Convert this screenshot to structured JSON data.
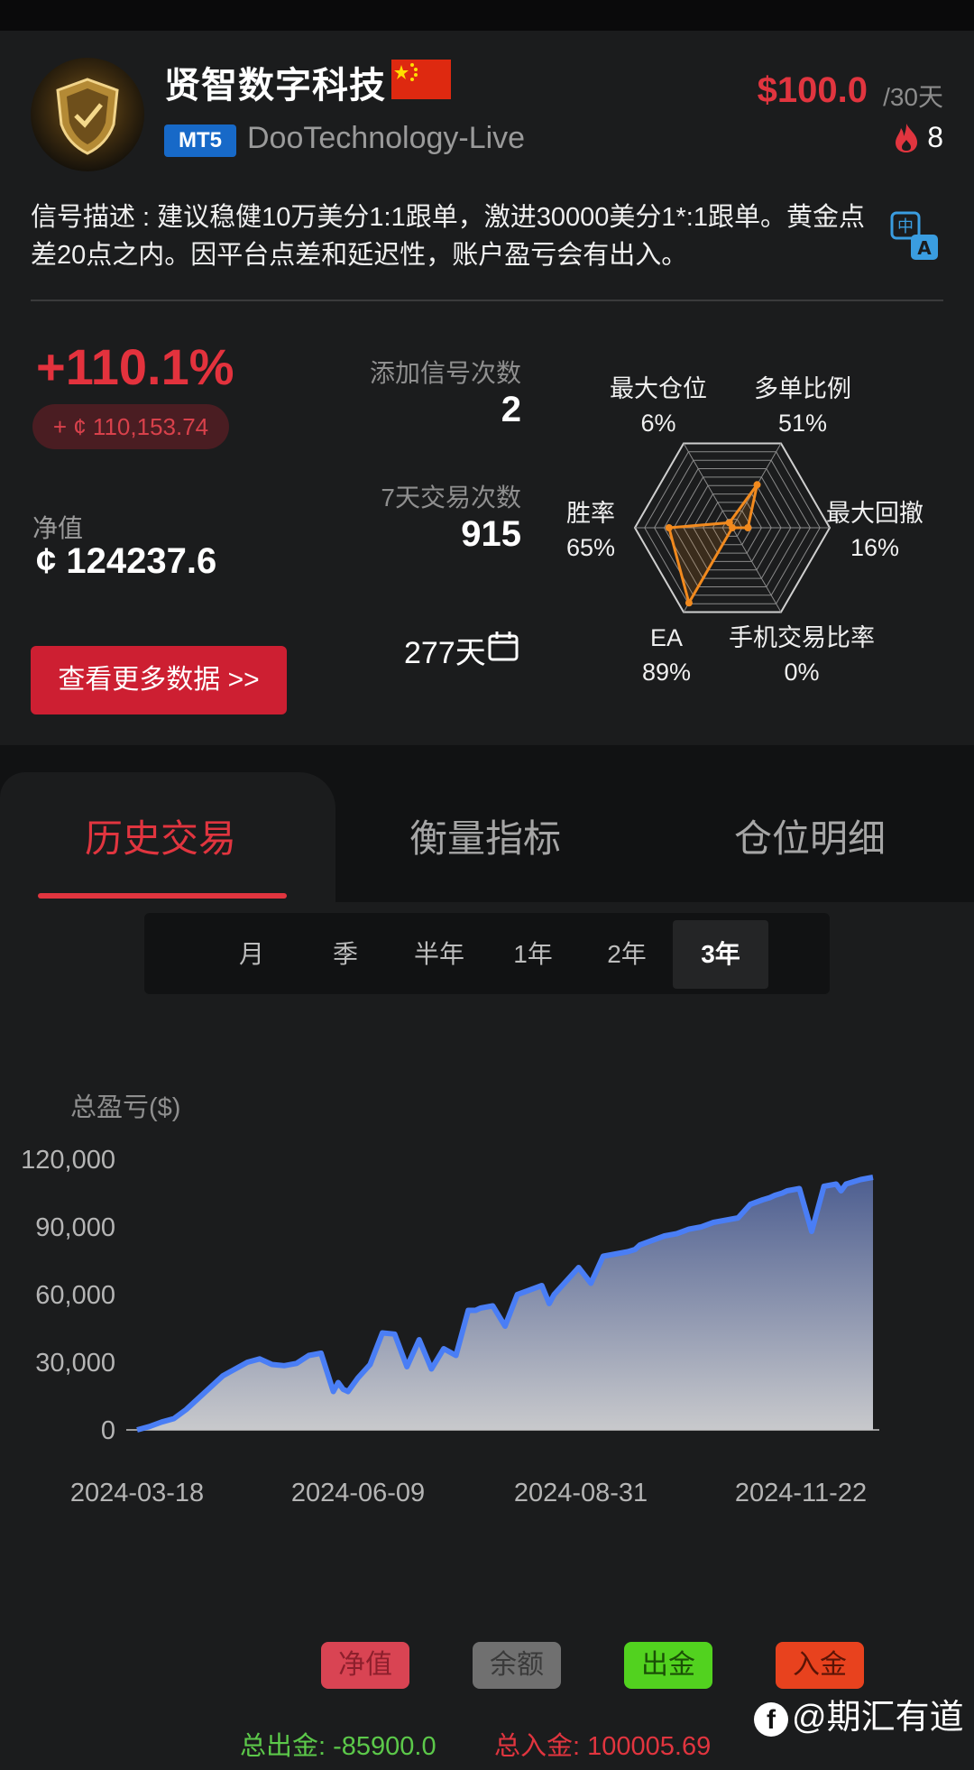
{
  "header": {
    "title": "贤智数字科技",
    "platform_badge": "MT5",
    "broker": "DooTechnology-Live",
    "price": "$100.0",
    "period": "/30天",
    "subscribers": "8"
  },
  "description": "信号描述 : 建议稳健10万美分1:1跟单，激进30000美分1*:1跟单。黄金点差20点之内。因平台点差和延迟性，账户盈亏会有出入。",
  "stats": {
    "return_pct": "+110.1%",
    "return_amount": "+ ¢ 110,153.74",
    "net_label": "净值",
    "net_value": "¢ 124237.6",
    "signal_add_label": "添加信号次数",
    "signal_add_value": "2",
    "trades_7d_label": "7天交易次数",
    "trades_7d_value": "915",
    "days": "277天",
    "more_button": "查看更多数据 >>"
  },
  "radar": {
    "items": [
      {
        "label": "多单比例",
        "value": "51%",
        "ratio": 0.51
      },
      {
        "label": "最大回撤",
        "value": "16%",
        "ratio": 0.16
      },
      {
        "label": "手机交易比率",
        "value": "0%",
        "ratio": 0.0
      },
      {
        "label": "EA",
        "value": "89%",
        "ratio": 0.89
      },
      {
        "label": "胜率",
        "value": "65%",
        "ratio": 0.65
      },
      {
        "label": "最大仓位",
        "value": "6%",
        "ratio": 0.06
      }
    ],
    "color": "#f28a1e"
  },
  "tabs": [
    "历史交易",
    "衡量指标",
    "仓位明细"
  ],
  "ranges": [
    "月",
    "季",
    "半年",
    "1年",
    "2年",
    "3年"
  ],
  "active_range": "3年",
  "chart_data": {
    "type": "area",
    "ylabel": "总盈亏($)",
    "ylim": [
      0,
      120000
    ],
    "yticks": [
      "0",
      "30,000",
      "60,000",
      "90,000",
      "120,000"
    ],
    "xticks": [
      "2024-03-18",
      "2024-06-09",
      "2024-08-31",
      "2024-11-22"
    ],
    "x": [
      0,
      5,
      10,
      15,
      20,
      25,
      30,
      35,
      40,
      45,
      50,
      55,
      60,
      65,
      70,
      75,
      80,
      82,
      84,
      86,
      90,
      95,
      100,
      105,
      110,
      115,
      120,
      125,
      130,
      135,
      138,
      140,
      145,
      150,
      155,
      160,
      165,
      168,
      170,
      175,
      180,
      185,
      190,
      195,
      200,
      203,
      205,
      210,
      215,
      220,
      225,
      230,
      235,
      240,
      245,
      250,
      255,
      258,
      260,
      263,
      265,
      270,
      275,
      280,
      285,
      287,
      289,
      292,
      295,
      300
    ],
    "values": [
      0,
      1500,
      3500,
      5000,
      9000,
      14000,
      19000,
      24000,
      27000,
      30000,
      31500,
      29000,
      28500,
      29500,
      33000,
      34000,
      17000,
      21000,
      18000,
      17000,
      23000,
      29000,
      43000,
      42500,
      28000,
      40000,
      27000,
      36000,
      33000,
      53000,
      53000,
      54000,
      55000,
      46000,
      60000,
      62000,
      64000,
      56000,
      60000,
      66000,
      72000,
      65000,
      77000,
      78000,
      79000,
      80000,
      82000,
      84000,
      86000,
      87000,
      89000,
      90000,
      92000,
      93000,
      94000,
      100000,
      102000,
      103000,
      104000,
      105000,
      106000,
      107000,
      88000,
      108000,
      109000,
      106000,
      109000,
      110000,
      111000,
      112000
    ],
    "line_color": "#4a7ef5"
  },
  "legend": {
    "net": "净值",
    "balance": "余额",
    "withdraw": "出金",
    "deposit": "入金"
  },
  "totals": {
    "withdraw": "总出金: -85900.0",
    "deposit": "总入金: 100005.69"
  },
  "watermark": "@期汇有道"
}
